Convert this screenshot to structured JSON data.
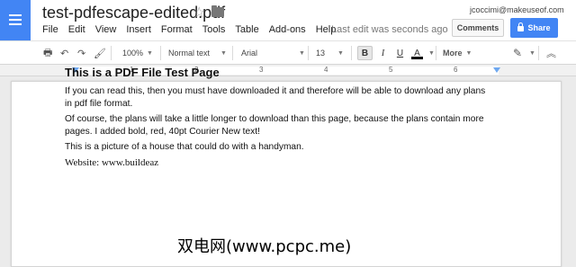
{
  "app": {
    "icon": "docs-icon"
  },
  "document": {
    "title": "test-pdfescape-edited.pdf"
  },
  "menu": [
    "File",
    "Edit",
    "View",
    "Insert",
    "Format",
    "Tools",
    "Table",
    "Add-ons",
    "Help"
  ],
  "last_edit": "Last edit was seconds ago",
  "user": {
    "email": "jcoccimi@makeuseof.com"
  },
  "buttons": {
    "comments": "Comments",
    "share": "Share"
  },
  "toolbar": {
    "zoom": "100%",
    "style": "Normal text",
    "font": "Arial",
    "size": "13",
    "bold": "B",
    "italic": "I",
    "underline": "U",
    "text_color": "A",
    "more": "More"
  },
  "ruler": {
    "numbers": [
      "1",
      "2",
      "3",
      "4",
      "5",
      "6"
    ]
  },
  "content": {
    "heading": "This is a PDF File Test Page",
    "paragraphs": [
      "If you can read this, then you must have downloaded it and therefore will be able to download any plans in pdf file format.",
      "Of course, the plans will take a little longer to download than this page, because the plans contain more pages. I added bold, red, 40pt Courier New text!",
      "This is a picture of a house that could do with a handyman."
    ],
    "website": "Website: www.buildeaz"
  },
  "watermark": "双电网(www.pcpc.me)",
  "colors": {
    "accent": "#4285f4",
    "text_color_bar": "#000000"
  }
}
